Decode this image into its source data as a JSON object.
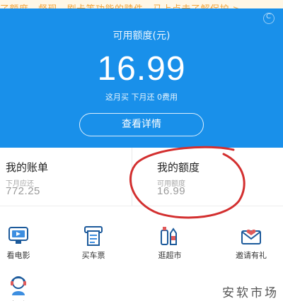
{
  "notice": {
    "text": "了额度，督现、刷卡等功能的赎件，马上点击了解保护 >"
  },
  "hero": {
    "label": "可用额度(元)",
    "amount": "16.99",
    "subtitle": "这月买 下月还 0费用",
    "detail_button": "查看详情"
  },
  "cards": {
    "bill": {
      "title": "我的账单",
      "label": "下月应还",
      "value": "772.25"
    },
    "quota": {
      "title": "我的额度",
      "label": "可用额度",
      "value": "16.99"
    }
  },
  "services": [
    {
      "label": "看电影",
      "icon": "movie-icon"
    },
    {
      "label": "买车票",
      "icon": "ticket-icon"
    },
    {
      "label": "逛超市",
      "icon": "supermarket-icon"
    },
    {
      "label": "邀请有礼",
      "icon": "invite-icon"
    },
    {
      "label": "帮助",
      "icon": "help-icon"
    }
  ],
  "watermark": "安软市场",
  "colors": {
    "brand_blue": "#1990ea",
    "notice_orange": "#f2a43a",
    "annotation_red": "#d32f2f"
  }
}
